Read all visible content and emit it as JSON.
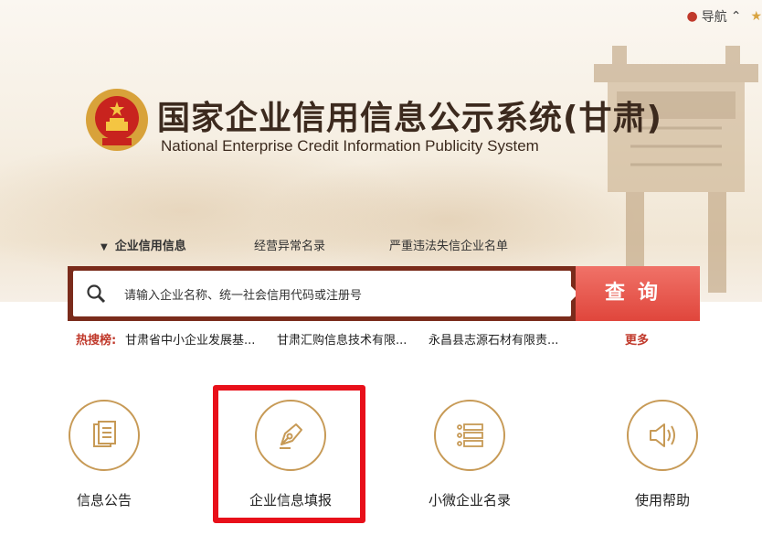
{
  "header": {
    "nav_label": "导航",
    "title_cn": "国家企业信用信息公示系统(甘肃)",
    "title_en": "National Enterprise Credit Information Publicity System"
  },
  "tabs": [
    {
      "label": "企业信用信息",
      "active": true
    },
    {
      "label": "经营异常名录",
      "active": false
    },
    {
      "label": "严重违法失信企业名单",
      "active": false
    }
  ],
  "search": {
    "placeholder": "请输入企业名称、统一社会信用代码或注册号",
    "button_label": "查询"
  },
  "hot_search": {
    "label": "热搜榜:",
    "items": [
      "甘肃省中小企业发展基...",
      "甘肃汇购信息技术有限...",
      "永昌县志源石材有限责..."
    ],
    "more_label": "更多"
  },
  "quick_links": [
    {
      "label": "信息公告",
      "icon": "document-icon"
    },
    {
      "label": "企业信息填报",
      "icon": "pen-icon"
    },
    {
      "label": "小微企业名录",
      "icon": "list-icon"
    },
    {
      "label": "使用帮助",
      "icon": "speaker-icon"
    }
  ],
  "colors": {
    "brown": "#7a2b1b",
    "query_red": "#e0463c",
    "gold": "#c79a56",
    "highlight_red": "#e8101a"
  }
}
